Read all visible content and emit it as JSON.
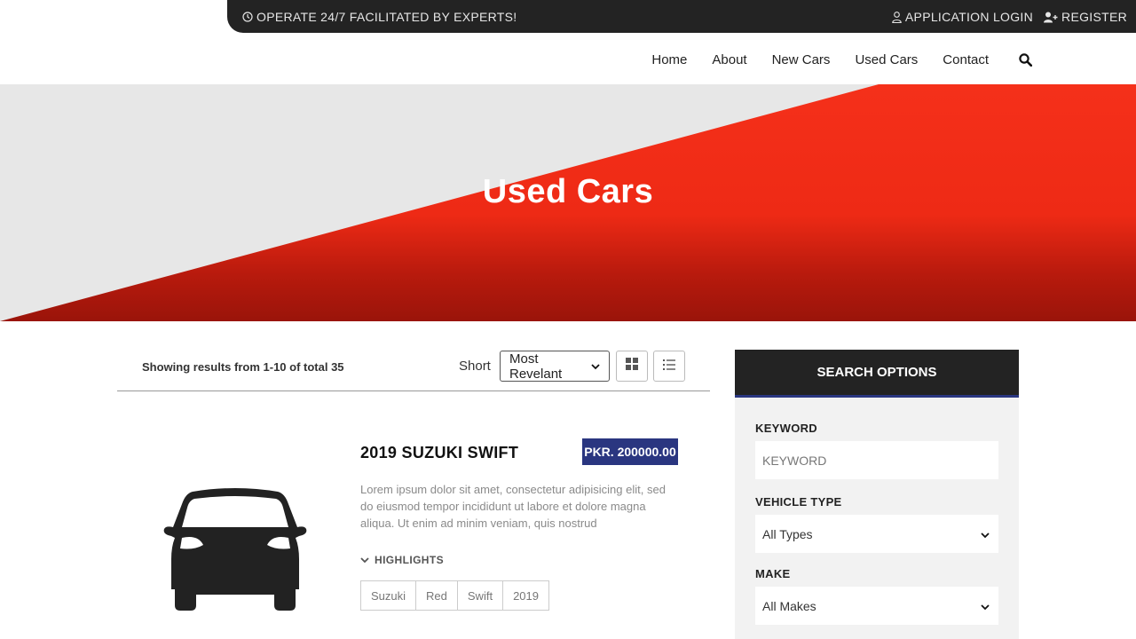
{
  "topbar": {
    "tagline": "OPERATE 24/7 FACILITATED BY EXPERTS!",
    "login": "APPLICATION LOGIN",
    "register": "REGISTER"
  },
  "nav": {
    "items": [
      "Home",
      "About",
      "New Cars",
      "Used Cars",
      "Contact"
    ]
  },
  "hero": {
    "title": "Used Cars"
  },
  "toolbar": {
    "results": "Showing results from 1-10 of total 35",
    "short_label": "Short",
    "sort_value": "Most Revelant"
  },
  "listing": {
    "title": "2019 SUZUKI SWIFT",
    "price": "PKR. 200000.00",
    "description": "Lorem ipsum dolor sit amet, consectetur adipisicing elit, sed do eiusmod tempor incididunt ut labore et dolore magna aliqua. Ut enim ad minim veniam, quis nostrud",
    "highlights_label": "HIGHLIGHTS",
    "tags": [
      "Suzuki",
      "Red",
      "Swift",
      "2019"
    ]
  },
  "search_options": {
    "title": "SEARCH OPTIONS",
    "keyword_label": "KEYWORD",
    "keyword_placeholder": "KEYWORD",
    "vehicle_type_label": "VEHICLE TYPE",
    "vehicle_type_value": "All Types",
    "make_label": "MAKE",
    "make_value": "All Makes"
  },
  "colors": {
    "brand_red": "#f5301a",
    "dark": "#232323",
    "accent_blue": "#2a3680"
  }
}
